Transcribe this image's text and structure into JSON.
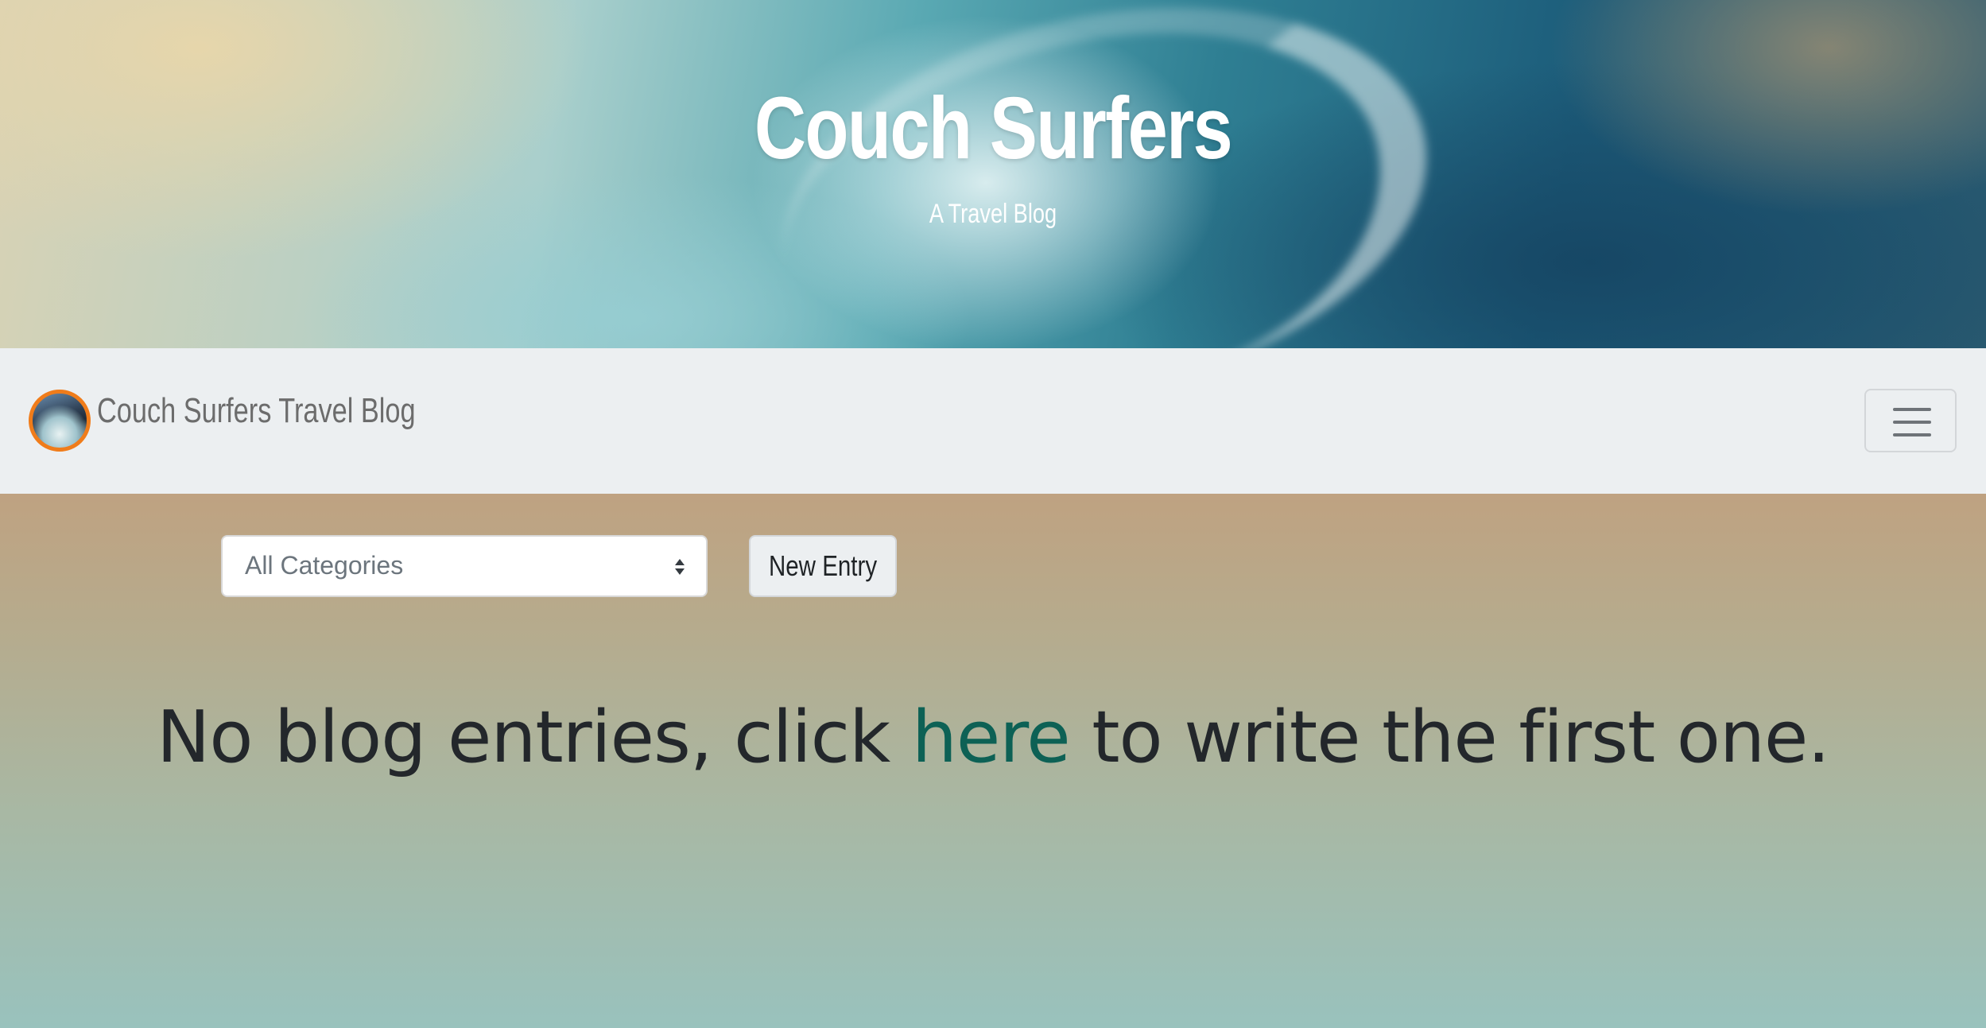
{
  "hero": {
    "title": "Couch Surfers",
    "subtitle": "A Travel Blog"
  },
  "navbar": {
    "brand_text": "Couch Surfers Travel Blog",
    "logo_border_color": "#f07c1a",
    "background_color": "#eceff1"
  },
  "filters": {
    "category_select_value": "All Categories",
    "new_entry_label": "New Entry"
  },
  "empty_state": {
    "prefix": "No blog entries, click ",
    "link_text": "here",
    "suffix": " to write the first one.",
    "link_color": "#0d6155"
  }
}
